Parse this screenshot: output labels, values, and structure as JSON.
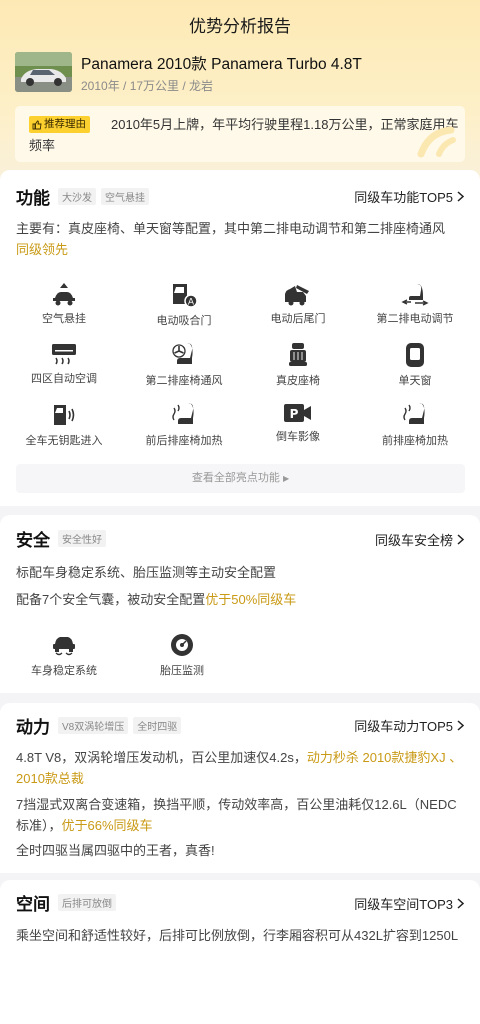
{
  "header": {
    "title": "优势分析报告"
  },
  "car": {
    "name": "Panamera 2010款 Panamera Turbo 4.8T",
    "meta": "2010年 / 17万公里 / 龙岩"
  },
  "reason": {
    "tag": "推荐理由",
    "text": "2010年5月上牌，年平均行驶里程1.18万公里，正常家庭用车频率"
  },
  "function": {
    "title": "功能",
    "tags": [
      "大沙发",
      "空气悬挂"
    ],
    "link": "同级车功能TOP5",
    "desc": "主要有：真皮座椅、单天窗等配置，其中第二排电动调节和第二排座椅通风",
    "desc_hl": "同级领先",
    "features": [
      {
        "label": "空气悬挂",
        "icon": "air-suspension-icon"
      },
      {
        "label": "电动吸合门",
        "icon": "soft-close-door-icon"
      },
      {
        "label": "电动后尾门",
        "icon": "power-tailgate-icon"
      },
      {
        "label": "第二排电动调节",
        "icon": "seat-adjust-icon"
      },
      {
        "label": "四区自动空调",
        "icon": "climate-control-icon"
      },
      {
        "label": "第二排座椅通风",
        "icon": "seat-ventilation-icon"
      },
      {
        "label": "真皮座椅",
        "icon": "leather-seat-icon"
      },
      {
        "label": "单天窗",
        "icon": "sunroof-icon"
      },
      {
        "label": "全车无钥匙进入",
        "icon": "keyless-entry-icon"
      },
      {
        "label": "前后排座椅加热",
        "icon": "seat-heating-icon"
      },
      {
        "label": "倒车影像",
        "icon": "reverse-camera-icon"
      },
      {
        "label": "前排座椅加热",
        "icon": "front-seat-heating-icon"
      }
    ],
    "more": "查看全部亮点功能"
  },
  "safety": {
    "title": "安全",
    "tags": [
      "安全性好"
    ],
    "link": "同级车安全榜",
    "line1": "标配车身稳定系统、胎压监测等主动安全配置",
    "line2": "配备7个安全气囊，被动安全配置",
    "line2_hl": "优于50%同级车",
    "features": [
      {
        "label": "车身稳定系统",
        "icon": "stability-control-icon"
      },
      {
        "label": "胎压监测",
        "icon": "tire-pressure-icon"
      }
    ]
  },
  "power": {
    "title": "动力",
    "tags": [
      "V8双涡轮增压",
      "全时四驱"
    ],
    "link": "同级车动力TOP5",
    "p1": "4.8T V8，双涡轮增压发动机，百公里加速仅4.2s，",
    "p1_hl": "动力秒杀 2010款捷豹XJ 、 2010款总裁",
    "p2": "7挡湿式双离合变速箱，换挡平顺，传动效率高，百公里油耗仅12.6L（NEDC标准），",
    "p2_hl": "优于66%同级车",
    "p3": "全时四驱当属四驱中的王者，真香!"
  },
  "space": {
    "title": "空间",
    "tags": [
      "后排可放倒"
    ],
    "link": "同级车空间TOP3",
    "desc": "乘坐空间和舒适性较好，后排可比例放倒，行李厢容积可从432L扩容到1250L"
  },
  "colors": {
    "accent": "#c99a16",
    "tag_yellow": "#fcd12f",
    "hero_bg": "#fde9b4"
  }
}
